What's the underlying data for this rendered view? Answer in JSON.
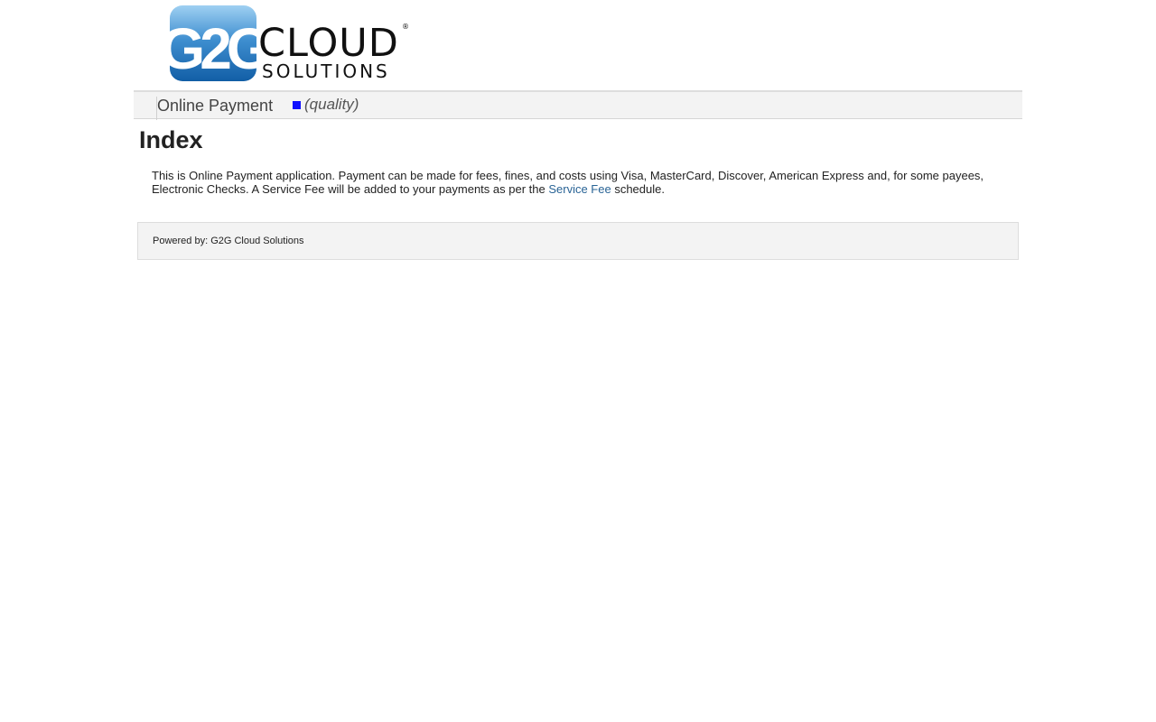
{
  "logo": {
    "mark_text": "G2G",
    "word_cloud": "CLOUD",
    "word_solutions": "SOLUTIONS",
    "registered": "®",
    "colors": {
      "mark_blue": "#1a6fb5",
      "mark_light": "#8ec5ec",
      "text": "#111111"
    }
  },
  "nav": {
    "title": "Online Payment",
    "environment_label": "(quality)",
    "environment_color": "#1010ff"
  },
  "main": {
    "title": "Index",
    "intro_before_link": "This is Online Payment application. Payment can be made for fees, fines, and costs using Visa, MasterCard, Discover, American Express and, for some payees, Electronic Checks. A Service Fee will be added to your payments as per the ",
    "service_fee_link": "Service Fee",
    "intro_after_link": " schedule."
  },
  "footer": {
    "powered_by": "Powered by: G2G Cloud Solutions"
  }
}
